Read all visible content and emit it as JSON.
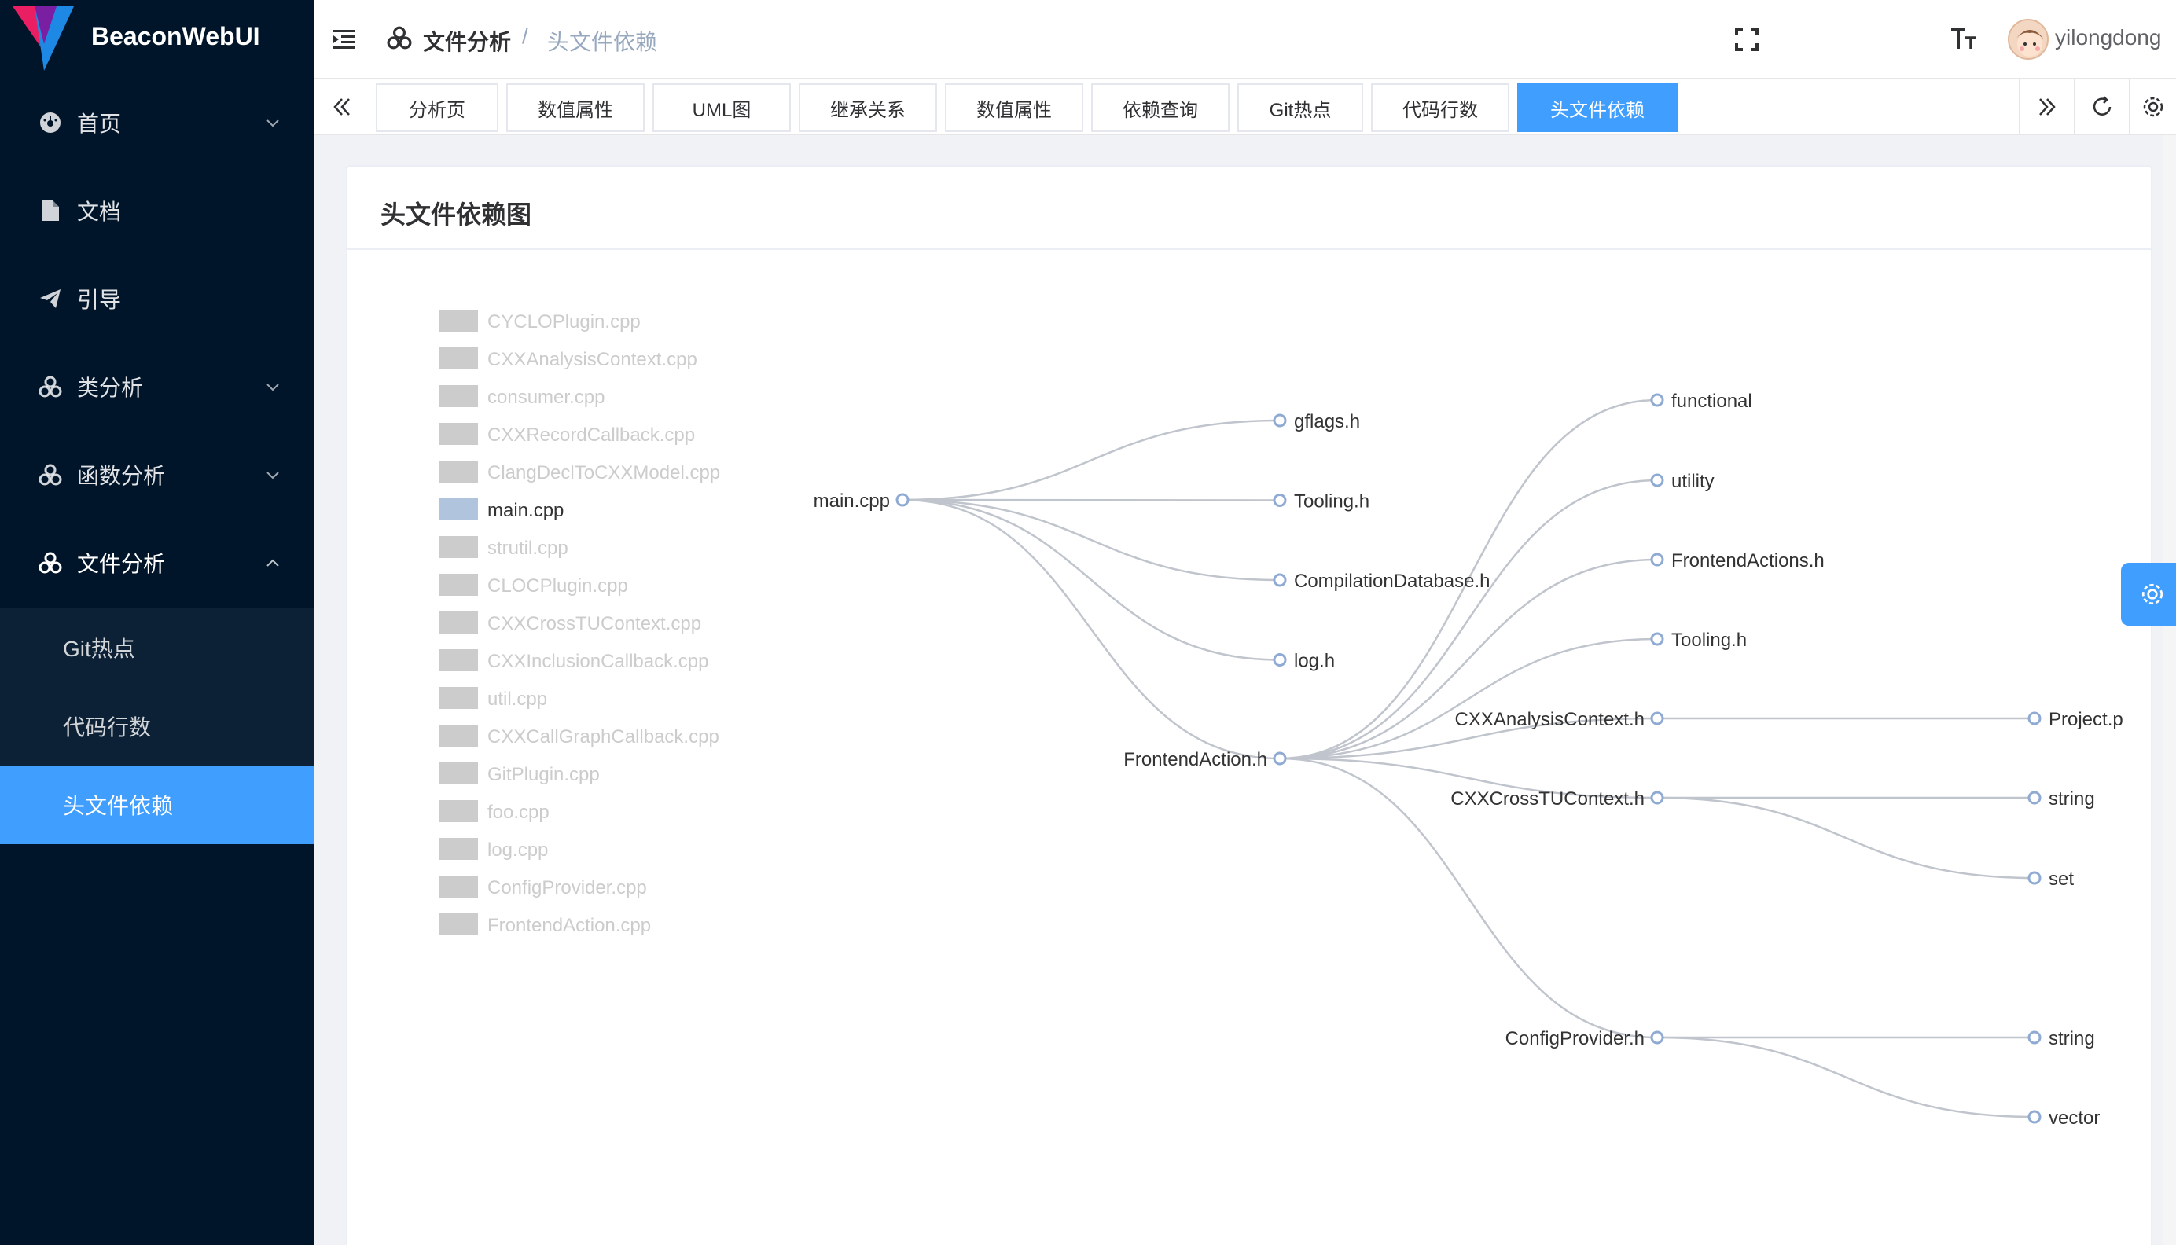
{
  "brand": {
    "title": "BeaconWebUI"
  },
  "sidebar": {
    "items": [
      {
        "label": "首页",
        "icon": "dashboard-icon",
        "arrow": "down"
      },
      {
        "label": "文档",
        "icon": "document-icon",
        "arrow": ""
      },
      {
        "label": "引导",
        "icon": "send-icon",
        "arrow": ""
      },
      {
        "label": "类分析",
        "icon": "cluster-icon",
        "arrow": "down"
      },
      {
        "label": "函数分析",
        "icon": "cluster-icon",
        "arrow": "down"
      },
      {
        "label": "文件分析",
        "icon": "cluster-icon",
        "arrow": "up"
      }
    ],
    "subitems": [
      {
        "label": "Git热点",
        "active": false
      },
      {
        "label": "代码行数",
        "active": false
      },
      {
        "label": "头文件依赖",
        "active": true
      }
    ]
  },
  "header": {
    "breadcrumb_current": "文件分析",
    "breadcrumb_sep": "/",
    "breadcrumb_last": "头文件依赖",
    "username": "yilongdong"
  },
  "tabs": [
    {
      "label": "分析页",
      "active": false
    },
    {
      "label": "数值属性",
      "active": false
    },
    {
      "label": "UML图",
      "active": false
    },
    {
      "label": "继承关系",
      "active": false
    },
    {
      "label": "数值属性",
      "active": false
    },
    {
      "label": "依赖查询",
      "active": false
    },
    {
      "label": "Git热点",
      "active": false
    },
    {
      "label": "代码行数",
      "active": false
    },
    {
      "label": "头文件依赖",
      "active": true
    }
  ],
  "card": {
    "title": "头文件依赖图"
  },
  "legend": [
    {
      "label": "CYCLOPlugin.cpp",
      "active": false
    },
    {
      "label": "CXXAnalysisContext.cpp",
      "active": false
    },
    {
      "label": "consumer.cpp",
      "active": false
    },
    {
      "label": "CXXRecordCallback.cpp",
      "active": false
    },
    {
      "label": "ClangDeclToCXXModel.cpp",
      "active": false
    },
    {
      "label": "main.cpp",
      "active": true
    },
    {
      "label": "strutil.cpp",
      "active": false
    },
    {
      "label": "CLOCPlugin.cpp",
      "active": false
    },
    {
      "label": "CXXCrossTUContext.cpp",
      "active": false
    },
    {
      "label": "CXXInclusionCallback.cpp",
      "active": false
    },
    {
      "label": "util.cpp",
      "active": false
    },
    {
      "label": "CXXCallGraphCallback.cpp",
      "active": false
    },
    {
      "label": "GitPlugin.cpp",
      "active": false
    },
    {
      "label": "foo.cpp",
      "active": false
    },
    {
      "label": "log.cpp",
      "active": false
    },
    {
      "label": "ConfigProvider.cpp",
      "active": false
    },
    {
      "label": "FrontendAction.cpp",
      "active": false
    }
  ],
  "tree": {
    "name": "main.cpp",
    "children": [
      {
        "name": "gflags.h"
      },
      {
        "name": "Tooling.h"
      },
      {
        "name": "CompilationDatabase.h"
      },
      {
        "name": "log.h"
      },
      {
        "name": "FrontendAction.h",
        "children": [
          {
            "name": "functional"
          },
          {
            "name": "utility"
          },
          {
            "name": "FrontendActions.h"
          },
          {
            "name": "Tooling.h"
          },
          {
            "name": "CXXAnalysisContext.h",
            "children": [
              {
                "name": "Project.p"
              }
            ]
          },
          {
            "name": "CXXCrossTUContext.h",
            "children": [
              {
                "name": "string"
              },
              {
                "name": "set"
              }
            ]
          },
          {
            "name": "ConfigProvider.h",
            "children": [
              {
                "name": "string"
              },
              {
                "name": "vector"
              }
            ]
          }
        ]
      }
    ]
  },
  "colors": {
    "accent": "#409eff",
    "sidebar_bg": "#001529",
    "link": "#c0c4cc",
    "node_stroke": "#8fabd3",
    "legend_inactive": "#cccccc",
    "legend_active": "#b0c4de"
  }
}
